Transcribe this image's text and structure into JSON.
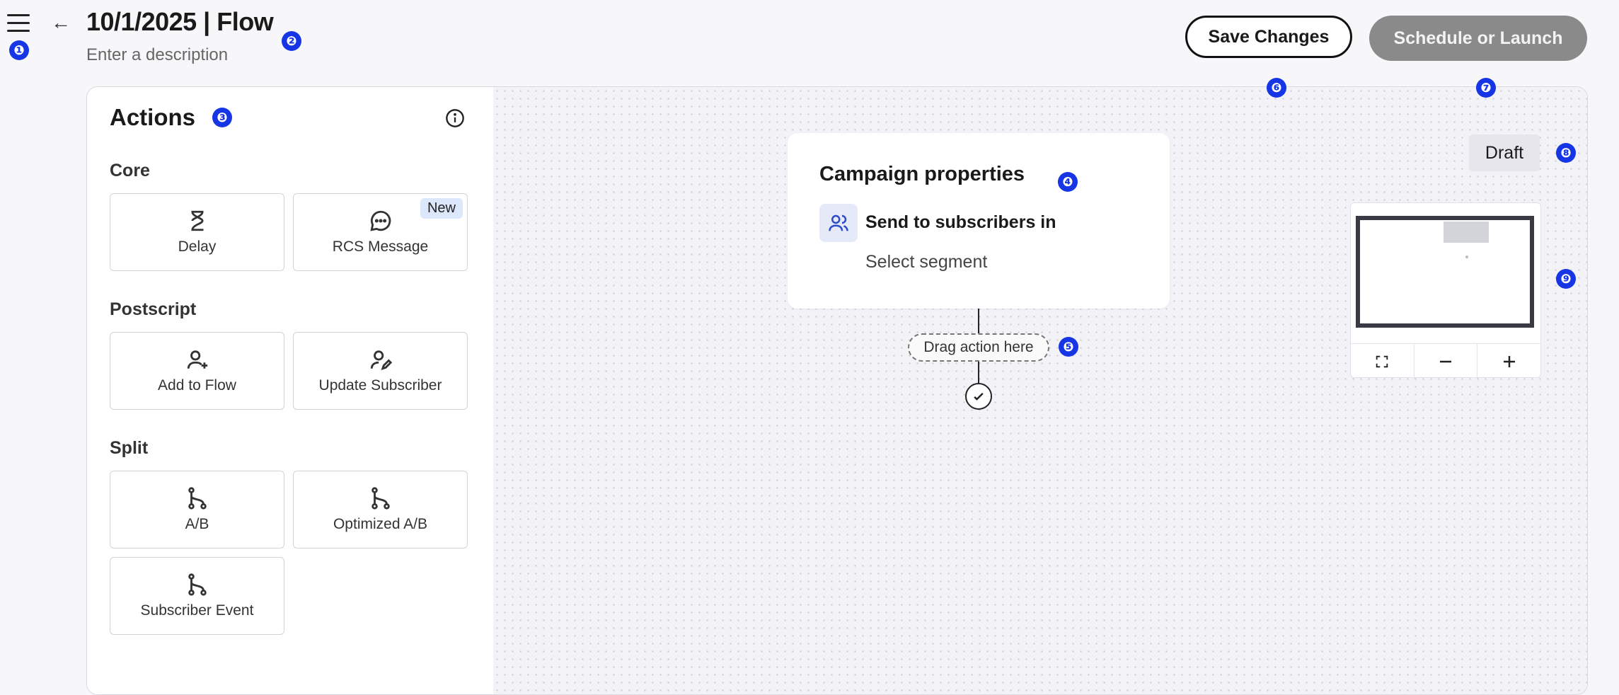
{
  "header": {
    "title": "10/1/2025 | Flow",
    "description_placeholder": "Enter a description",
    "save_label": "Save Changes",
    "launch_label": "Schedule or Launch"
  },
  "actions": {
    "title": "Actions",
    "sections": [
      {
        "title": "Core",
        "items": [
          {
            "label": "Delay",
            "icon": "hourglass-icon"
          },
          {
            "label": "RCS Message",
            "icon": "chat-bubble-icon",
            "badge": "New"
          }
        ]
      },
      {
        "title": "Postscript",
        "items": [
          {
            "label": "Add to Flow",
            "icon": "user-plus-icon"
          },
          {
            "label": "Update Subscriber",
            "icon": "user-edit-icon"
          }
        ]
      },
      {
        "title": "Split",
        "items": [
          {
            "label": "A/B",
            "icon": "branch-icon"
          },
          {
            "label": "Optimized A/B",
            "icon": "branch-icon"
          },
          {
            "label": "Subscriber Event",
            "icon": "branch-icon"
          }
        ]
      }
    ]
  },
  "canvas": {
    "card_title": "Campaign properties",
    "send_label": "Send to subscribers in",
    "segment_label": "Select segment",
    "drag_label": "Drag action here",
    "status": "Draft"
  },
  "markers": [
    "❶",
    "❷",
    "❸",
    "❹",
    "❺",
    "❻",
    "❼",
    "❽",
    "❾"
  ]
}
